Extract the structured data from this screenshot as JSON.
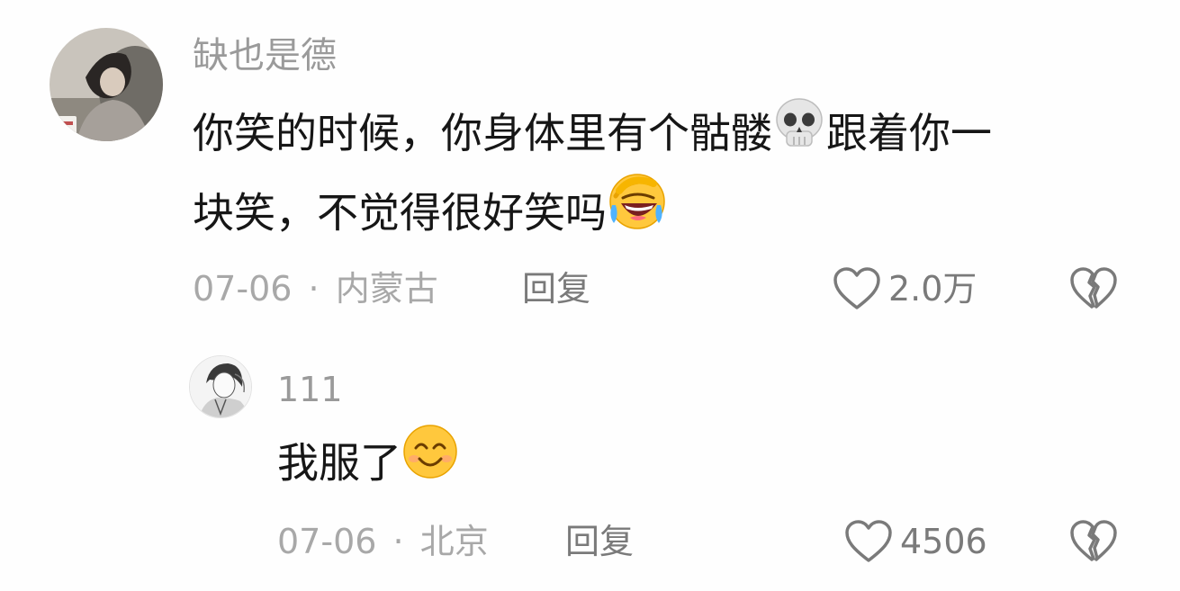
{
  "comments": [
    {
      "username": "缺也是德",
      "text_part1": "你笑的时候，你身体里有个骷髅",
      "text_part2": "跟着你一",
      "text_part3": "块笑，不觉得很好笑吗",
      "emojis": [
        "skull-emoji",
        "rofl-crying-laugh-emoji"
      ],
      "date": "07-06",
      "separator": "·",
      "location": "内蒙古",
      "reply_label": "回复",
      "like_count": "2.0万"
    }
  ],
  "replies": [
    {
      "username": "111",
      "text": "我服了",
      "emojis": [
        "smiling-face-emoji"
      ],
      "date": "07-06",
      "separator": "·",
      "location": "北京",
      "reply_label": "回复",
      "like_count": "4506"
    }
  ],
  "icons": {
    "like": "heart-outline-icon",
    "dislike": "broken-heart-icon"
  },
  "colors": {
    "username": "#9a9a9a",
    "content": "#161616",
    "meta": "#a8a8a8",
    "action": "#7a7a7a",
    "emoji_yellow": "#ffc83d"
  }
}
